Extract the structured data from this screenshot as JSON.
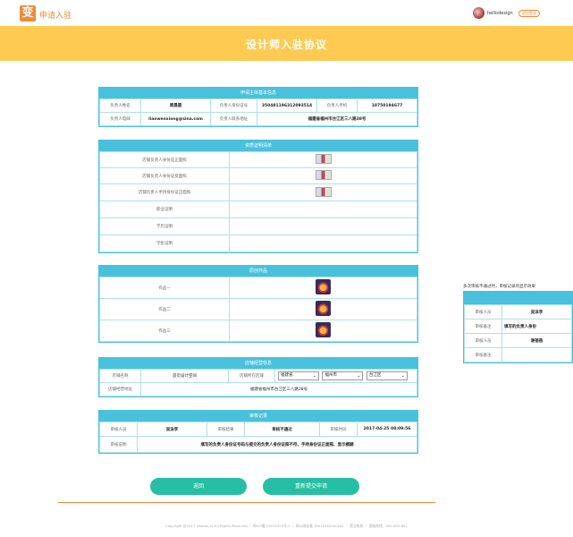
{
  "header": {
    "logo_char": "变",
    "logo_text": "申请入驻",
    "username": "hellodesign",
    "logout": "退出登录"
  },
  "banner": {
    "title": "设计师入驻协议"
  },
  "basic": {
    "title": "申请主体基本信息",
    "r1": {
      "l1": "负责人姓名",
      "v1": "周晟晟",
      "l2": "负责人身份证号",
      "v2": "350481196312093514",
      "l3": "负责人手机",
      "v3": "18750194677"
    },
    "r2": {
      "l1": "负责人电邮",
      "v1": "liaowenxiong@sina.com",
      "l2": "负责人联系地址",
      "v2": "福建省福州市台江区三八路38号"
    }
  },
  "docs": {
    "title": "资质证明清单",
    "rows": [
      {
        "label": "店铺负责人身份证正面照",
        "img": true
      },
      {
        "label": "店铺负责人身份证反面照",
        "img": true
      },
      {
        "label": "店铺负责人手持身份证正面照",
        "img": true
      },
      {
        "label": "职业证明",
        "img": false
      },
      {
        "label": "学历证明",
        "img": false
      },
      {
        "label": "学生证明",
        "img": false
      }
    ]
  },
  "works": {
    "title": "原创作品",
    "rows": [
      {
        "label": "作品一"
      },
      {
        "label": "作品二"
      },
      {
        "label": "作品三"
      }
    ]
  },
  "shop": {
    "title": "店铺经营信息",
    "name_label": "店铺名称",
    "name_value": "首页设计空间",
    "region_label": "店铺所在区域",
    "province": "福建省",
    "city": "福州市",
    "district": "台江区",
    "address_label": "店铺经营地址",
    "address_value": "福建省福州市台江区三八路38号"
  },
  "review": {
    "title": "审核记录",
    "l1": "审核人员",
    "v1": "吴泳李",
    "l2": "审核结果",
    "v2": "审核不通过",
    "l3": "审核时间",
    "v3": "2017-04-25 08:09:56",
    "note_label": "审核说明",
    "note_value": "填写的负责人身份证号码与提交的负责人身份证照不符，手持身份证正面照、显示模糊"
  },
  "buttons": {
    "back": "返回",
    "resubmit": "重新提交申请"
  },
  "footer": "Copyright @2017 yinbian.cc All Rights Reserved ｜ 闽ICP备 15015375号-2 ｜ 闽公网安备 35010302000161 ｜ 营业执照 ｜ 客服热线：400-800-851",
  "side": {
    "note": "多次审核不通过时，审核记录的显示效果",
    "rows": [
      {
        "label": "审核人员",
        "value": "吴泳李"
      },
      {
        "label": "审核备注",
        "value": "填写的负责人身份"
      },
      {
        "label": "审核人员",
        "value": "谢蓓蓓"
      },
      {
        "label": "审核备注",
        "value": ""
      }
    ]
  }
}
